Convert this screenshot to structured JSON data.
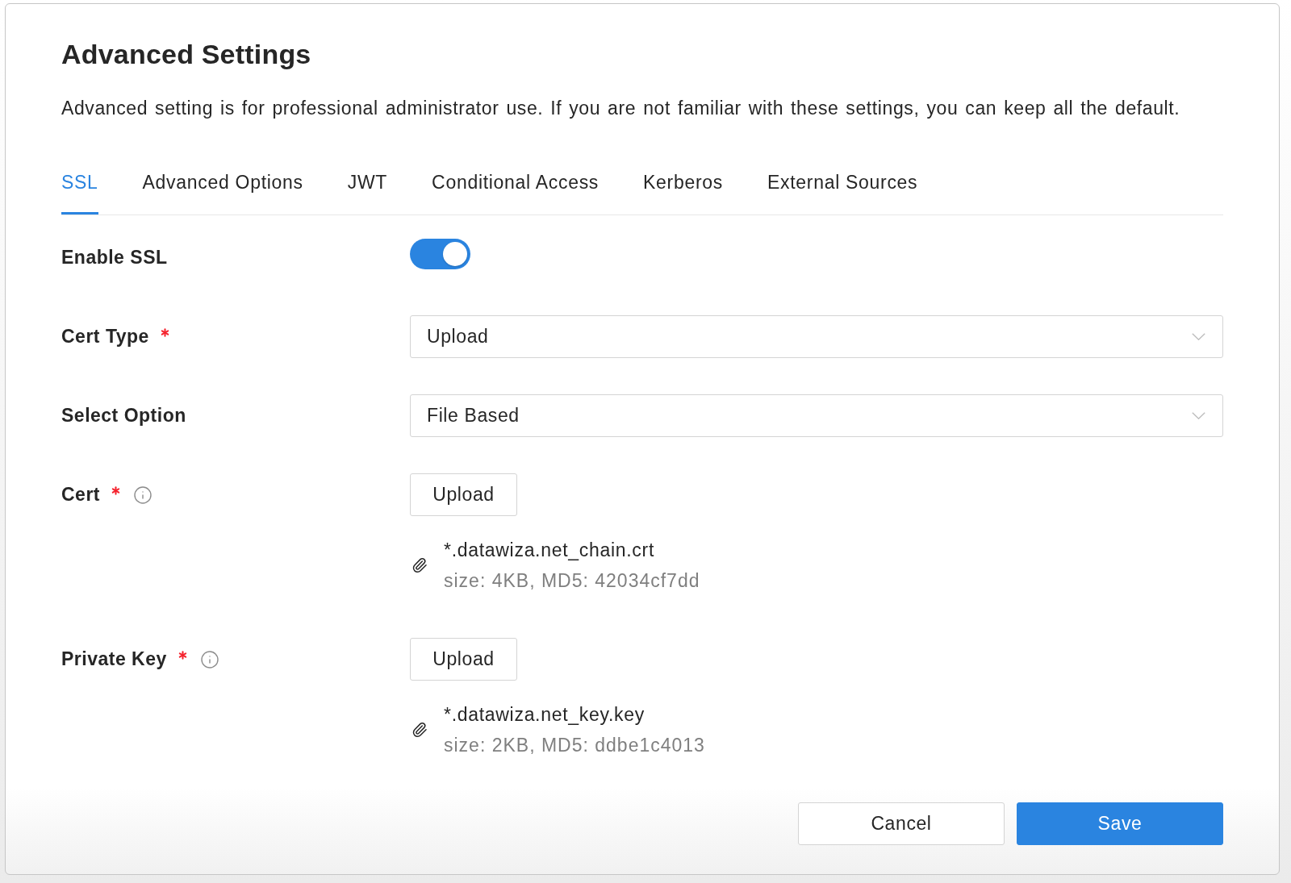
{
  "dialog": {
    "title": "Advanced Settings",
    "description": "Advanced setting is for professional administrator use. If you are not familiar with these settings, you can keep all the default."
  },
  "tabs": [
    {
      "label": "SSL",
      "selected": true
    },
    {
      "label": "Advanced Options",
      "selected": false
    },
    {
      "label": "JWT",
      "selected": false
    },
    {
      "label": "Conditional Access",
      "selected": false
    },
    {
      "label": "Kerberos",
      "selected": false
    },
    {
      "label": "External Sources",
      "selected": false
    }
  ],
  "form": {
    "fields": [
      {
        "kind": "toggle",
        "label": "Enable SSL",
        "required": false,
        "info": false,
        "on": true
      },
      {
        "kind": "select",
        "label": "Cert Type",
        "required": true,
        "info": false,
        "value": "Upload"
      },
      {
        "kind": "select",
        "label": "Select Option",
        "required": false,
        "info": false,
        "value": "File Based"
      },
      {
        "kind": "upload",
        "label": "Cert",
        "required": true,
        "info": true,
        "button": "Upload",
        "file": {
          "name": "*.datawiza.net_chain.crt",
          "details": "size: 4KB, MD5: 42034cf7dd"
        }
      },
      {
        "kind": "upload",
        "label": "Private Key",
        "required": true,
        "info": true,
        "button": "Upload",
        "file": {
          "name": "*.datawiza.net_key.key",
          "details": "size: 2KB, MD5: ddbe1c4013"
        }
      }
    ]
  },
  "buttons": [
    {
      "kind": "cancel",
      "label": "Cancel"
    },
    {
      "kind": "save",
      "label": "Save"
    }
  ]
}
